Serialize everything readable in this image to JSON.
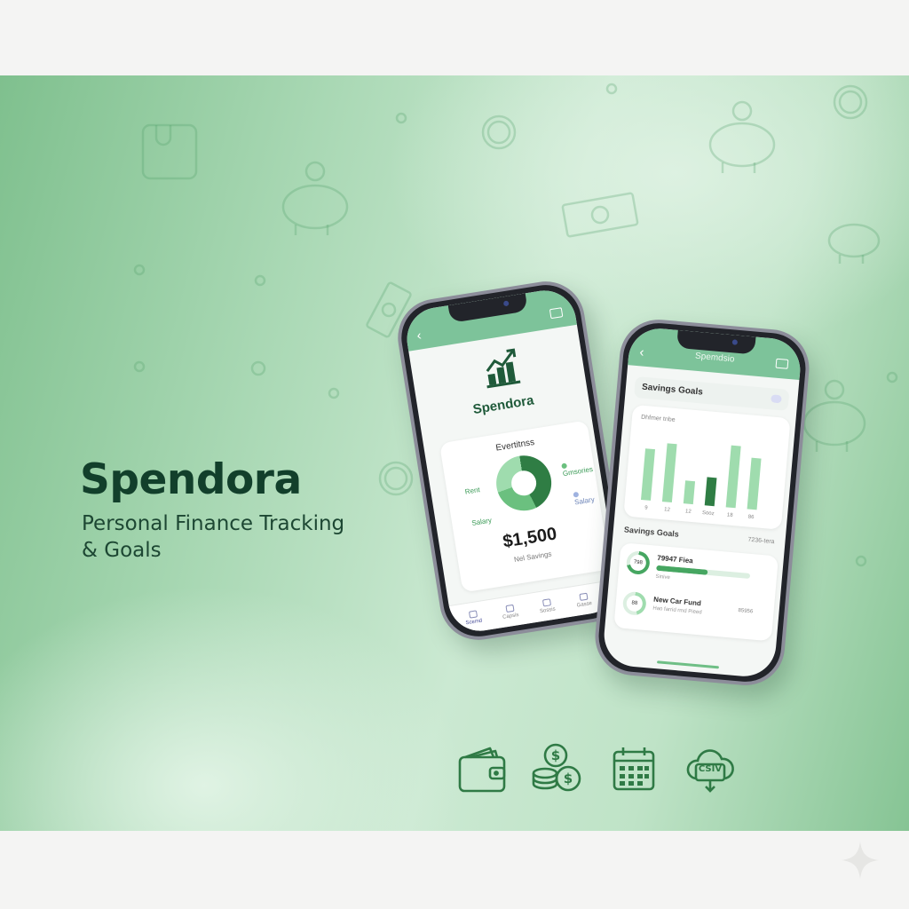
{
  "brand": {
    "name": "Spendora",
    "tagline_line1": "Personal Finance Tracking",
    "tagline_line2": "& Goals"
  },
  "colors": {
    "primary_dark": "#123f2b",
    "accent_green": "#46a661",
    "topbar_green": "#7dc39a",
    "dark_green": "#2f7d44",
    "light_green": "#9fdcae"
  },
  "phone_left": {
    "topbar_back_icon": "chevron-left-icon",
    "topbar_right_icon": "export-icon",
    "app_name": "Spendora",
    "logo_icon": "growth-chart-icon",
    "expenses": {
      "title": "Evertitnss",
      "labels": {
        "rent": "Rent",
        "salary_left": "Salary",
        "groceries": "Gmsories",
        "salary_right": "Salary"
      },
      "amount": "$1,500",
      "amount_label": "Nel Savings"
    },
    "nav": [
      "Scemd",
      "Capsis",
      "Sossis",
      "Gasse"
    ]
  },
  "phone_right": {
    "topbar_title": "Spemdsio",
    "savings_header": "Savings Goals",
    "chart_title": "Dhfmer tnbe",
    "bar_labels": [
      "9",
      "12",
      "12",
      "Sooz",
      "18",
      "86"
    ],
    "goals_title": "Savings Goals",
    "goals_right": "7236-tera",
    "goals": [
      {
        "ring_label": "798",
        "name": "79947 Fiea",
        "sub": "Sinive",
        "progress": 0.55,
        "amount": ""
      },
      {
        "ring_label": "88",
        "name": "New Car Fund",
        "sub": "Hao farrid rmd Pieed",
        "progress": 0,
        "amount": "85956"
      }
    ]
  },
  "features": {
    "icons": [
      "wallet-icon",
      "coins-icon",
      "calendar-icon",
      "cloud-csv-icon"
    ],
    "csv_text": "CSIV"
  }
}
